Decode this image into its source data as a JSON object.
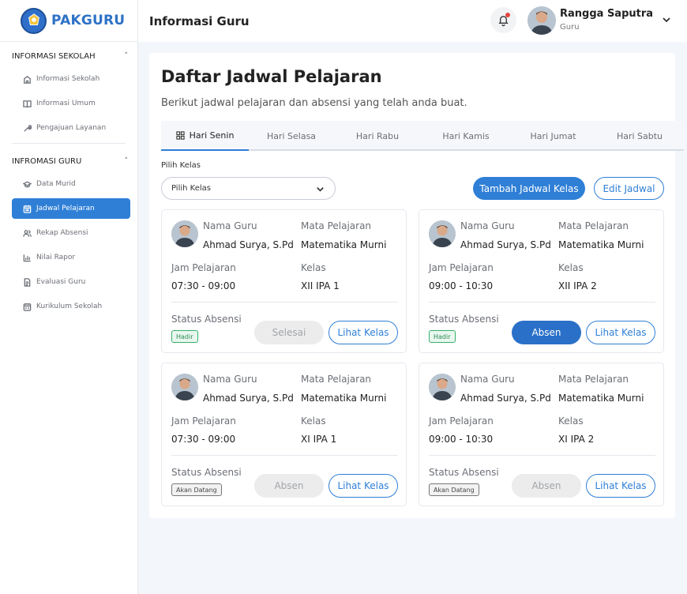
{
  "app": {
    "name": "PAKGURU"
  },
  "sidebar": {
    "sections": [
      {
        "title": "INFORMASI SEKOLAH",
        "items": [
          {
            "label": "Informasi Sekolah",
            "icon": "school-icon"
          },
          {
            "label": "Informasi Umum",
            "icon": "book-icon"
          },
          {
            "label": "Pengajuan Layanan",
            "icon": "tool-icon"
          }
        ]
      },
      {
        "title": "INFROMASI GURU",
        "items": [
          {
            "label": "Data Murid",
            "icon": "graduation-cap-icon"
          },
          {
            "label": "Jadwal Pelajaran",
            "icon": "calendar-icon",
            "active": true
          },
          {
            "label": "Rekap Absensi",
            "icon": "users-icon"
          },
          {
            "label": "Nilai Rapor",
            "icon": "bar-chart-icon"
          },
          {
            "label": "Evaluasi Guru",
            "icon": "document-icon"
          },
          {
            "label": "Kurikulum Sekolah",
            "icon": "calendar-icon"
          }
        ]
      }
    ]
  },
  "header": {
    "title": "Informasi Guru",
    "user": {
      "name": "Rangga Saputra",
      "role": "Guru"
    }
  },
  "main": {
    "title": "Daftar Jadwal Pelajaran",
    "subtitle": "Berikut jadwal pelajaran dan absensi yang telah anda buat.",
    "tabs": [
      "Hari Senin",
      "Hari Selasa",
      "Hari Rabu",
      "Hari Kamis",
      "Hari Jumat",
      "Hari Sabtu"
    ],
    "filter": {
      "label": "Pilih Kelas",
      "value": "Pilih Kelas"
    },
    "add_button": "Tambah Jadwal Kelas",
    "edit_button": "Edit Jadwal",
    "labels": {
      "teacher": "Nama Guru",
      "subject": "Mata Pelajaran",
      "time": "Jam Pelajaran",
      "class": "Kelas",
      "status": "Status Absensi",
      "view": "Lihat Kelas"
    },
    "cards": [
      {
        "teacher": "Ahmad Surya, S.Pd",
        "subject": "Matematika Murni",
        "time": "07:30 - 09:00",
        "class": "XII IPA 1",
        "status": "Hadir",
        "action": "Selesai"
      },
      {
        "teacher": "Ahmad Surya, S.Pd",
        "subject": "Matematika Murni",
        "time": "09:00 - 10:30",
        "class": "XII IPA 2",
        "status": "Hadir",
        "action": "Absen"
      },
      {
        "teacher": "Ahmad Surya, S.Pd",
        "subject": "Matematika Murni",
        "time": "07:30 - 09:00",
        "class": "XI IPA 1",
        "status": "Akan Datang",
        "action": "Absen"
      },
      {
        "teacher": "Ahmad Surya, S.Pd",
        "subject": "Matematika Murni",
        "time": "09:00 - 10:30",
        "class": "XI IPA 2",
        "status": "Akan Datang",
        "action": "Absen"
      }
    ]
  },
  "colors": {
    "primary": "#2f7fd6",
    "success": "#35b06a",
    "brand_text": "#2d72c6"
  }
}
